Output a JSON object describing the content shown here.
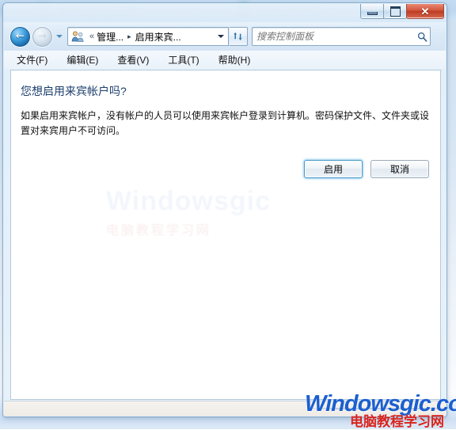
{
  "window": {
    "caption_buttons": [
      {
        "name": "minimize",
        "label": "–"
      },
      {
        "name": "maximize",
        "label": "□"
      },
      {
        "name": "close",
        "label": "✕"
      }
    ]
  },
  "navbar": {
    "back_label": "←",
    "forward_label": "→",
    "recent_pages_label": "▾",
    "breadcrumb": {
      "icon": "user-accounts-icon",
      "overflow_label": "«",
      "items": [
        {
          "label": "管理..."
        },
        {
          "label": "启用来宾..."
        }
      ],
      "separator": "▸",
      "dropdown_label": "▾"
    },
    "refresh_label": "refresh-icon",
    "search": {
      "placeholder": "搜索控制面板",
      "value": "",
      "icon": "search-icon"
    }
  },
  "menubar": {
    "items": [
      {
        "label": "文件(F)"
      },
      {
        "label": "编辑(E)"
      },
      {
        "label": "查看(V)"
      },
      {
        "label": "工具(T)"
      },
      {
        "label": "帮助(H)"
      }
    ]
  },
  "content": {
    "title": "您想启用来宾帐户吗?",
    "body": "如果启用来宾帐户，没有帐户的人员可以使用来宾帐户登录到计算机。密码保护文件、文件夹或设置对来宾用户不可访问。",
    "buttons": {
      "primary_label": "启用",
      "cancel_label": "取消"
    },
    "faint_watermark": {
      "line1": "Windowsgic",
      "line2": "电脑教程学习网"
    }
  },
  "watermark": {
    "brand": "Windowsgic.com",
    "chinese": "电脑教程学习网"
  },
  "colors": {
    "title_text": "#1c3f6e",
    "accent_blue": "#4a9cc9",
    "close_red": "#bb3c23",
    "watermark_blue": "#1b5fd0",
    "watermark_red": "#d8241e"
  }
}
